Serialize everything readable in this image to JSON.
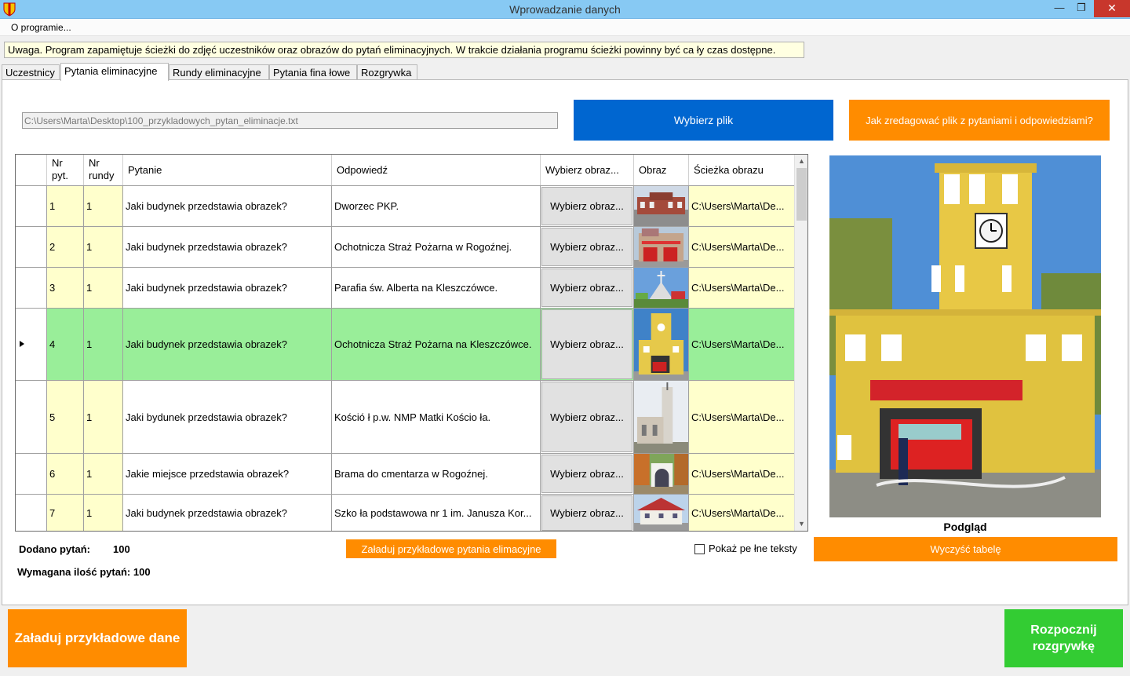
{
  "window": {
    "title": "Wprowadzanie danych",
    "minimize": "—",
    "restore": "❐",
    "close": "✕"
  },
  "menu": {
    "about": "O programie..."
  },
  "notice": "Uwaga. Program zapamiętuje ścieżki do zdjęć uczestników oraz obrazów do pytań eliminacyjnych. W trakcie działania programu ścieżki powinny być ca ły czas dostępne.",
  "tabs": [
    {
      "label": "Uczestnicy"
    },
    {
      "label": "Pytania eliminacyjne"
    },
    {
      "label": "Rundy eliminacyjne"
    },
    {
      "label": "Pytania fina łowe"
    },
    {
      "label": "Rozgrywka"
    }
  ],
  "file": {
    "path": "C:\\Users\\Marta\\Desktop\\100_przykladowych_pytan_eliminacje.txt",
    "choose_label": "Wybierz plik",
    "help_label": "Jak zredagować plik z pytaniami i odpowiedziami?"
  },
  "table": {
    "headers": {
      "nr_pyt": "Nr pyt.",
      "nr_rundy": "Nr rundy",
      "pytanie": "Pytanie",
      "odpowiedz": "Odpowiedź",
      "wybierz": "Wybierz obraz...",
      "obraz": "Obraz",
      "sciezka": "Ścieżka obrazu"
    },
    "rows": [
      {
        "nr": "1",
        "runda": "1",
        "pytanie": "Jaki budynek przedstawia obrazek?",
        "odpowiedz": "Dworzec PKP.",
        "btn": "Wybierz obraz...",
        "sciezka": "C:\\Users\\Marta\\De..."
      },
      {
        "nr": "2",
        "runda": "1",
        "pytanie": "Jaki budynek przedstawia obrazek?",
        "odpowiedz": "Ochotnicza Straż Pożarna w Rogoźnej.",
        "btn": "Wybierz obraz...",
        "sciezka": "C:\\Users\\Marta\\De..."
      },
      {
        "nr": "3",
        "runda": "1",
        "pytanie": "Jaki budynek przedstawia obrazek?",
        "odpowiedz": "Parafia św. Alberta na Kleszczówce.",
        "btn": "Wybierz obraz...",
        "sciezka": "C:\\Users\\Marta\\De..."
      },
      {
        "nr": "4",
        "runda": "1",
        "pytanie": "Jaki budynek przedstawia obrazek?",
        "odpowiedz": "Ochotnicza Straż Pożarna na Kleszczówce.",
        "btn": "Wybierz obraz...",
        "sciezka": "C:\\Users\\Marta\\De..."
      },
      {
        "nr": "5",
        "runda": "1",
        "pytanie": "Jaki bydunek przedstawia obrazek?",
        "odpowiedz": "Kośció ł p.w. NMP Matki Kościo ła.",
        "btn": "Wybierz obraz...",
        "sciezka": "C:\\Users\\Marta\\De..."
      },
      {
        "nr": "6",
        "runda": "1",
        "pytanie": "Jakie miejsce przedstawia obrazek?",
        "odpowiedz": "Brama do cmentarza w Rogoźnej.",
        "btn": "Wybierz obraz...",
        "sciezka": "C:\\Users\\Marta\\De..."
      },
      {
        "nr": "7",
        "runda": "1",
        "pytanie": "Jaki budynek przedstawia obrazek?",
        "odpowiedz": "Szko ła podstawowa nr 1 im. Janusza Kor...",
        "btn": "Wybierz obraz...",
        "sciezka": "C:\\Users\\Marta\\De..."
      }
    ]
  },
  "preview_label": "Podgląd",
  "stats": {
    "added_label": "Dodano pytań:",
    "added_value": "100",
    "required_label": "Wymagana ilość pytań: 100"
  },
  "buttons": {
    "load_sample_questions": "Załaduj przykładowe pytania elimacyjne",
    "show_full_texts": "Pokaż pe łne teksty",
    "clear_table": "Wyczyść tabelę",
    "load_sample_data": "Załaduj przykładowe dane",
    "start_line1": "Rozpocznij",
    "start_line2": "rozgrywkę"
  },
  "colors": {
    "accent_blue": "#0066d0",
    "accent_orange": "#ff8c00",
    "accent_green": "#33cc33",
    "selected_row": "#99ee99",
    "readonly_cell": "#ffffcc"
  }
}
